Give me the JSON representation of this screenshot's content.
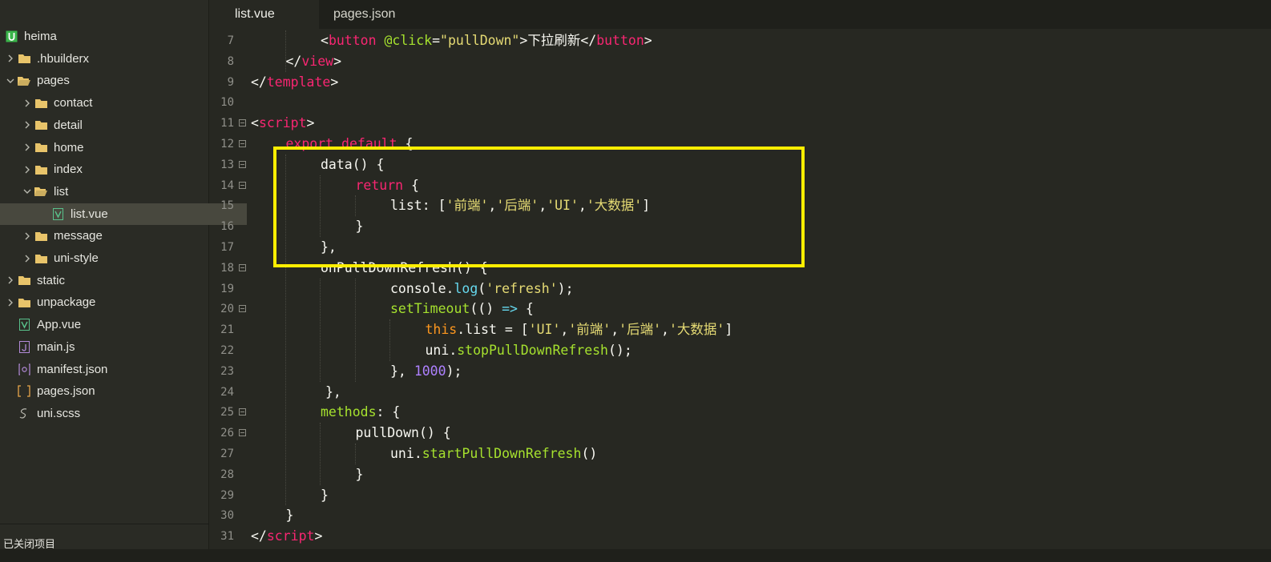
{
  "sidebar": {
    "items": [
      {
        "label": "heima",
        "icon": "project-u-icon",
        "chevron": "",
        "depth": 0,
        "kind": "project"
      },
      {
        "label": ".hbuilderx",
        "icon": "folder-icon",
        "chevron": "right",
        "depth": 0,
        "kind": "folder"
      },
      {
        "label": "pages",
        "icon": "folder-open-icon",
        "chevron": "down",
        "depth": 0,
        "kind": "folder-open"
      },
      {
        "label": "contact",
        "icon": "folder-icon",
        "chevron": "right",
        "depth": 1,
        "kind": "folder"
      },
      {
        "label": "detail",
        "icon": "folder-icon",
        "chevron": "right",
        "depth": 1,
        "kind": "folder"
      },
      {
        "label": "home",
        "icon": "folder-icon",
        "chevron": "right",
        "depth": 1,
        "kind": "folder"
      },
      {
        "label": "index",
        "icon": "folder-icon",
        "chevron": "right",
        "depth": 1,
        "kind": "folder"
      },
      {
        "label": "list",
        "icon": "folder-open-icon",
        "chevron": "down",
        "depth": 1,
        "kind": "folder-open"
      },
      {
        "label": "list.vue",
        "icon": "vue-file-icon",
        "chevron": "",
        "depth": 2,
        "kind": "vue",
        "selected": true
      },
      {
        "label": "message",
        "icon": "folder-icon",
        "chevron": "right",
        "depth": 1,
        "kind": "folder"
      },
      {
        "label": "uni-style",
        "icon": "folder-icon",
        "chevron": "right",
        "depth": 1,
        "kind": "folder"
      },
      {
        "label": "static",
        "icon": "folder-icon",
        "chevron": "right",
        "depth": 0,
        "kind": "folder"
      },
      {
        "label": "unpackage",
        "icon": "folder-icon",
        "chevron": "right",
        "depth": 0,
        "kind": "folder"
      },
      {
        "label": "App.vue",
        "icon": "vue-file-icon",
        "chevron": "",
        "depth": 0,
        "kind": "vue"
      },
      {
        "label": "main.js",
        "icon": "js-file-icon",
        "chevron": "",
        "depth": 0,
        "kind": "js"
      },
      {
        "label": "manifest.json",
        "icon": "manifest-file-icon",
        "chevron": "",
        "depth": 0,
        "kind": "manifest"
      },
      {
        "label": "pages.json",
        "icon": "json-file-icon",
        "chevron": "",
        "depth": 0,
        "kind": "json"
      },
      {
        "label": "uni.scss",
        "icon": "scss-file-icon",
        "chevron": "",
        "depth": 0,
        "kind": "scss"
      }
    ],
    "status": "已关闭项目"
  },
  "tabs": [
    {
      "label": "list.vue",
      "active": true
    },
    {
      "label": "pages.json",
      "active": false
    }
  ],
  "editor": {
    "lines": [
      {
        "n": "7",
        "fold": false,
        "indent": 2,
        "tokens": [
          {
            "t": "<",
            "c": ""
          },
          {
            "t": "button",
            "c": "t-tag"
          },
          {
            "t": " ",
            "c": ""
          },
          {
            "t": "@click",
            "c": "t-attr"
          },
          {
            "t": "=",
            "c": ""
          },
          {
            "t": "\"pullDown\"",
            "c": "t-str"
          },
          {
            "t": ">",
            "c": ""
          },
          {
            "t": "下拉刷新",
            "c": "t-cn"
          },
          {
            "t": "</",
            "c": ""
          },
          {
            "t": "button",
            "c": "t-tag"
          },
          {
            "t": ">",
            "c": ""
          }
        ]
      },
      {
        "n": "8",
        "fold": false,
        "indent": 1,
        "tokens": [
          {
            "t": "</",
            "c": ""
          },
          {
            "t": "view",
            "c": "t-tag"
          },
          {
            "t": ">",
            "c": ""
          }
        ]
      },
      {
        "n": "9",
        "fold": false,
        "indent": 0,
        "tokens": [
          {
            "t": "</",
            "c": ""
          },
          {
            "t": "template",
            "c": "t-tag"
          },
          {
            "t": ">",
            "c": ""
          }
        ]
      },
      {
        "n": "10",
        "fold": false,
        "indent": 0,
        "tokens": []
      },
      {
        "n": "11",
        "fold": true,
        "indent": 0,
        "tokens": [
          {
            "t": "<",
            "c": ""
          },
          {
            "t": "script",
            "c": "t-tag"
          },
          {
            "t": ">",
            "c": ""
          }
        ]
      },
      {
        "n": "12",
        "fold": true,
        "indent": 1,
        "tokens": [
          {
            "t": "export default",
            "c": "t-kw"
          },
          {
            "t": " {",
            "c": ""
          }
        ]
      },
      {
        "n": "13",
        "fold": true,
        "indent": 2,
        "tokens": [
          {
            "t": "data",
            "c": ""
          },
          {
            "t": "() {",
            "c": ""
          }
        ]
      },
      {
        "n": "14",
        "fold": true,
        "indent": 3,
        "tokens": [
          {
            "t": "return",
            "c": "t-kw"
          },
          {
            "t": " {",
            "c": ""
          }
        ]
      },
      {
        "n": "15",
        "fold": false,
        "indent": 4,
        "tokens": [
          {
            "t": "list: [",
            "c": ""
          },
          {
            "t": "'前端'",
            "c": "t-str"
          },
          {
            "t": ",",
            "c": ""
          },
          {
            "t": "'后端'",
            "c": "t-str"
          },
          {
            "t": ",",
            "c": ""
          },
          {
            "t": "'UI'",
            "c": "t-str"
          },
          {
            "t": ",",
            "c": ""
          },
          {
            "t": "'大数据'",
            "c": "t-str"
          },
          {
            "t": "]",
            "c": ""
          }
        ]
      },
      {
        "n": "16",
        "fold": false,
        "indent": 3,
        "tokens": [
          {
            "t": "}",
            "c": ""
          }
        ]
      },
      {
        "n": "17",
        "fold": false,
        "indent": 2,
        "tokens": [
          {
            "t": "},",
            "c": ""
          }
        ]
      },
      {
        "n": "18",
        "fold": true,
        "indent": 2,
        "tokens": [
          {
            "t": "onPullDownRefresh",
            "c": ""
          },
          {
            "t": "() {",
            "c": ""
          }
        ]
      },
      {
        "n": "19",
        "fold": false,
        "indent": 4,
        "tokens": [
          {
            "t": "console",
            "c": ""
          },
          {
            "t": ".",
            "c": ""
          },
          {
            "t": "log",
            "c": "t-op"
          },
          {
            "t": "(",
            "c": ""
          },
          {
            "t": "'refresh'",
            "c": "t-str"
          },
          {
            "t": ");",
            "c": ""
          }
        ]
      },
      {
        "n": "20",
        "fold": true,
        "indent": 4,
        "tokens": [
          {
            "t": "setTimeout",
            "c": "t-fn"
          },
          {
            "t": "(() ",
            "c": ""
          },
          {
            "t": "=>",
            "c": "t-op"
          },
          {
            "t": " {",
            "c": ""
          }
        ]
      },
      {
        "n": "21",
        "fold": false,
        "indent": 5,
        "tokens": [
          {
            "t": "this",
            "c": "t-this"
          },
          {
            "t": ".",
            "c": ""
          },
          {
            "t": "list = [",
            "c": ""
          },
          {
            "t": "'UI'",
            "c": "t-str"
          },
          {
            "t": ",",
            "c": ""
          },
          {
            "t": "'前端'",
            "c": "t-str"
          },
          {
            "t": ",",
            "c": ""
          },
          {
            "t": "'后端'",
            "c": "t-str"
          },
          {
            "t": ",",
            "c": ""
          },
          {
            "t": "'大数据'",
            "c": "t-str"
          },
          {
            "t": "]",
            "c": ""
          }
        ]
      },
      {
        "n": "22",
        "fold": false,
        "indent": 5,
        "tokens": [
          {
            "t": "uni",
            "c": ""
          },
          {
            "t": ".",
            "c": ""
          },
          {
            "t": "stopPullDownRefresh",
            "c": "t-fn"
          },
          {
            "t": "();",
            "c": ""
          }
        ]
      },
      {
        "n": "23",
        "fold": false,
        "indent": 4,
        "tokens": [
          {
            "t": "}, ",
            "c": ""
          },
          {
            "t": "1000",
            "c": "t-num"
          },
          {
            "t": ");",
            "c": ""
          }
        ]
      },
      {
        "n": "24",
        "fold": false,
        "indent": 2,
        "extra": 1,
        "tokens": [
          {
            "t": "},",
            "c": ""
          }
        ]
      },
      {
        "n": "25",
        "fold": true,
        "indent": 2,
        "tokens": [
          {
            "t": "methods",
            "c": "t-attr"
          },
          {
            "t": ": {",
            "c": ""
          }
        ]
      },
      {
        "n": "26",
        "fold": true,
        "indent": 3,
        "tokens": [
          {
            "t": "pullDown",
            "c": ""
          },
          {
            "t": "() {",
            "c": ""
          }
        ]
      },
      {
        "n": "27",
        "fold": false,
        "indent": 4,
        "tokens": [
          {
            "t": "uni",
            "c": ""
          },
          {
            "t": ".",
            "c": ""
          },
          {
            "t": "startPullDownRefresh",
            "c": "t-fn"
          },
          {
            "t": "()",
            "c": ""
          }
        ]
      },
      {
        "n": "28",
        "fold": false,
        "indent": 3,
        "tokens": [
          {
            "t": "}",
            "c": ""
          }
        ]
      },
      {
        "n": "29",
        "fold": false,
        "indent": 2,
        "tokens": [
          {
            "t": "}",
            "c": ""
          }
        ]
      },
      {
        "n": "30",
        "fold": false,
        "indent": 1,
        "tokens": [
          {
            "t": "}",
            "c": ""
          }
        ]
      },
      {
        "n": "31",
        "fold": false,
        "indent": 0,
        "tokens": [
          {
            "t": "</",
            "c": ""
          },
          {
            "t": "script",
            "c": "t-tag"
          },
          {
            "t": ">",
            "c": ""
          }
        ]
      }
    ]
  },
  "colors": {
    "editor_bg": "#272822",
    "sidebar_bg": "#2a2b25",
    "highlight_border": "#ffee00",
    "folder_icon": "#e8c46a",
    "vue_icon": "#59c18b",
    "project_icon": "#3ab54a"
  }
}
